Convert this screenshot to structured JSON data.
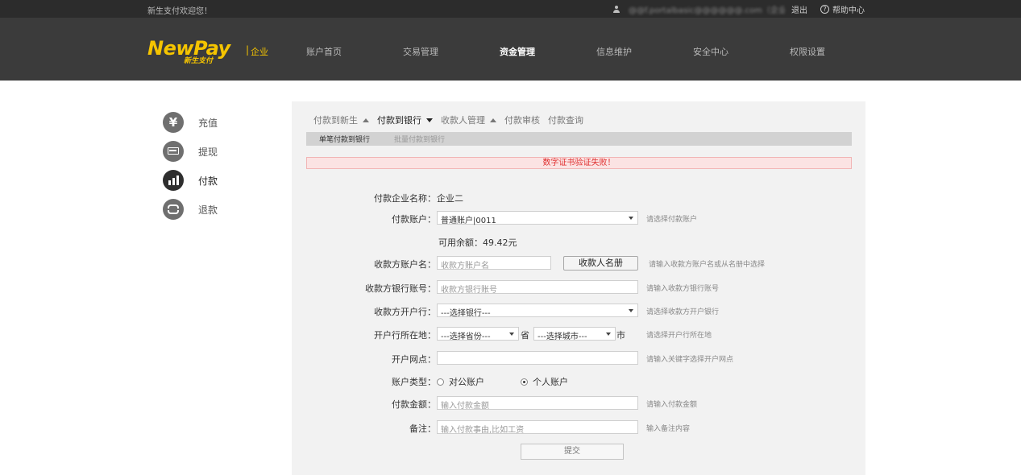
{
  "topbar": {
    "welcome": "新生支付欢迎您！",
    "user_name": "@@f.portalbasic@@@@@@.com（企业二）",
    "logout": "退出",
    "help": "帮助中心"
  },
  "header": {
    "brand": "NewPay",
    "brand_sub": "新生支付",
    "brand_sep": "|",
    "brand_biz": "企业",
    "nav": [
      {
        "label": "账户首页"
      },
      {
        "label": "交易管理"
      },
      {
        "label": "资金管理"
      },
      {
        "label": "信息维护"
      },
      {
        "label": "安全中心"
      },
      {
        "label": "权限设置"
      }
    ],
    "active_nav": 2
  },
  "sidebar": {
    "items": [
      {
        "label": "充值",
        "icon": "yen-icon"
      },
      {
        "label": "提现",
        "icon": "card-icon"
      },
      {
        "label": "付款",
        "icon": "bar-chart-icon"
      },
      {
        "label": "退款",
        "icon": "refund-arrows-icon"
      }
    ],
    "active": 2
  },
  "subnav": {
    "items": [
      {
        "label": "付款到新生"
      },
      {
        "label": "付款到银行"
      },
      {
        "label": "收款人管理"
      },
      {
        "label": "付款审核"
      },
      {
        "label": "付款查询"
      }
    ]
  },
  "tabs": {
    "items": [
      {
        "label": "单笔付款到银行"
      },
      {
        "label": "批量付款到银行"
      }
    ]
  },
  "alert": "数字证书验证失败！",
  "form": {
    "company_label": "付款企业名称：",
    "company_value": "企业二",
    "account_label": "付款账户：",
    "account_value": "普通账户|0011",
    "account_hint": "请选择付款账户",
    "balance": "可用余额：49.42元",
    "payee_name_label": "收款方账户名：",
    "payee_name_placeholder": "收款方账户名",
    "payee_book_button": "收款人名册",
    "payee_name_hint": "请输入收款方账户名或从名册中选择",
    "payee_acct_label": "收款方银行账号：",
    "payee_acct_placeholder": "收款方银行账号",
    "payee_acct_hint": "请输入收款方银行账号",
    "bank_label": "收款方开户行：",
    "bank_value": "---选择银行---",
    "bank_hint": "请选择收款方开户银行",
    "location_label": "开户行所在地：",
    "province_value": "---选择省份---",
    "province_unit": "省",
    "city_value": "---选择城市---",
    "city_unit": "市",
    "location_hint": "请选择开户行所在地",
    "branch_label": "开户网点：",
    "branch_hint": "请输入关键字选择开户网点",
    "type_label": "账户类型：",
    "type_public": "对公账户",
    "type_personal": "个人账户",
    "amount_label": "付款金额：",
    "amount_placeholder": "输入付款金额",
    "amount_hint": "请输入付款金额",
    "memo_label": "备注：",
    "memo_placeholder": "输入付款事由,比如工资",
    "memo_hint": "输入备注内容",
    "submit": "提交"
  }
}
